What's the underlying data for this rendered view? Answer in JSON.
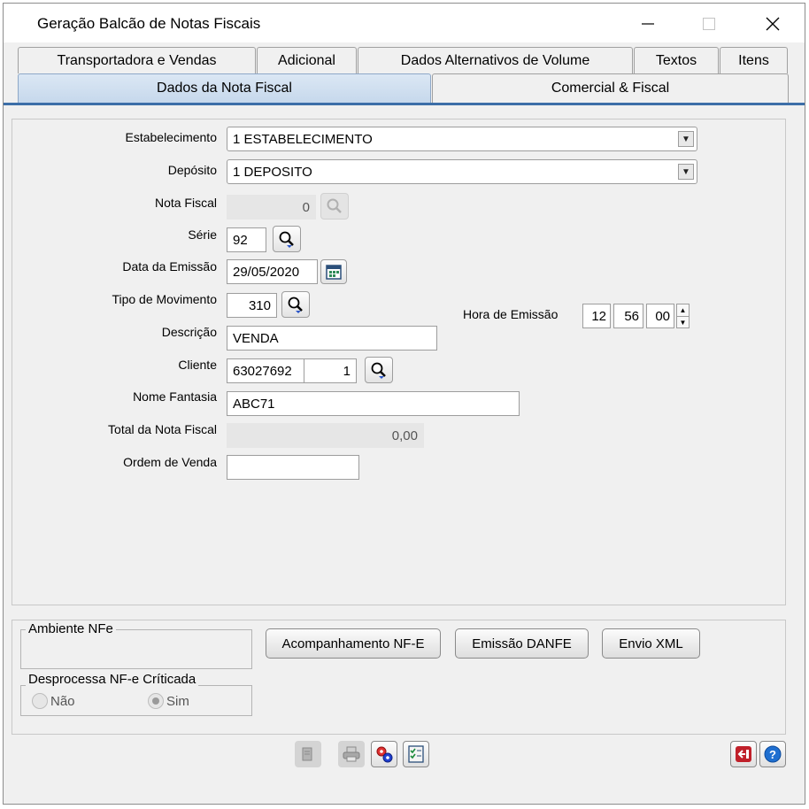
{
  "window": {
    "title": "Geração Balcão de Notas Fiscais"
  },
  "tabs_top": [
    "Transportadora e Vendas",
    "Adicional",
    "Dados Alternativos de Volume",
    "Textos",
    "Itens"
  ],
  "tabs_bottom": {
    "active": "Dados da Nota Fiscal",
    "other": "Comercial & Fiscal"
  },
  "form": {
    "estabelecimento": {
      "label": "Estabelecimento",
      "value": "1 ESTABELECIMENTO"
    },
    "deposito": {
      "label": "Depósito",
      "value": "1 DEPOSITO"
    },
    "nota_fiscal": {
      "label": "Nota Fiscal",
      "value": "0"
    },
    "serie": {
      "label": "Série",
      "value": "92"
    },
    "data_emissao": {
      "label": "Data da Emissão",
      "value": "29/05/2020"
    },
    "tipo_movimento": {
      "label": "Tipo de Movimento",
      "value": "310"
    },
    "hora_emissao": {
      "label": "Hora de Emissão",
      "hh": "12",
      "mm": "56",
      "ss": "00"
    },
    "descricao": {
      "label": "Descrição",
      "value": "VENDA"
    },
    "cliente": {
      "label": "Cliente",
      "code": "63027692",
      "seq": "1"
    },
    "nome_fantasia": {
      "label": "Nome Fantasia",
      "value": "ABC71"
    },
    "total_nota": {
      "label": "Total da Nota Fiscal",
      "value": "0,00"
    },
    "ordem_venda": {
      "label": "Ordem de Venda",
      "value": ""
    }
  },
  "ambiente": {
    "title": "Ambiente NFe"
  },
  "desprocessa": {
    "title": "Desprocessa NF-e Críticada",
    "nao": "Não",
    "sim": "Sim",
    "selected": "Sim"
  },
  "buttons": {
    "acompanhamento": "Acompanhamento NF-E",
    "emissao": "Emissão DANFE",
    "envio": "Envio XML"
  },
  "colors": {
    "accent": "#3c6ea8",
    "active_tab": "#c6d8ec"
  }
}
